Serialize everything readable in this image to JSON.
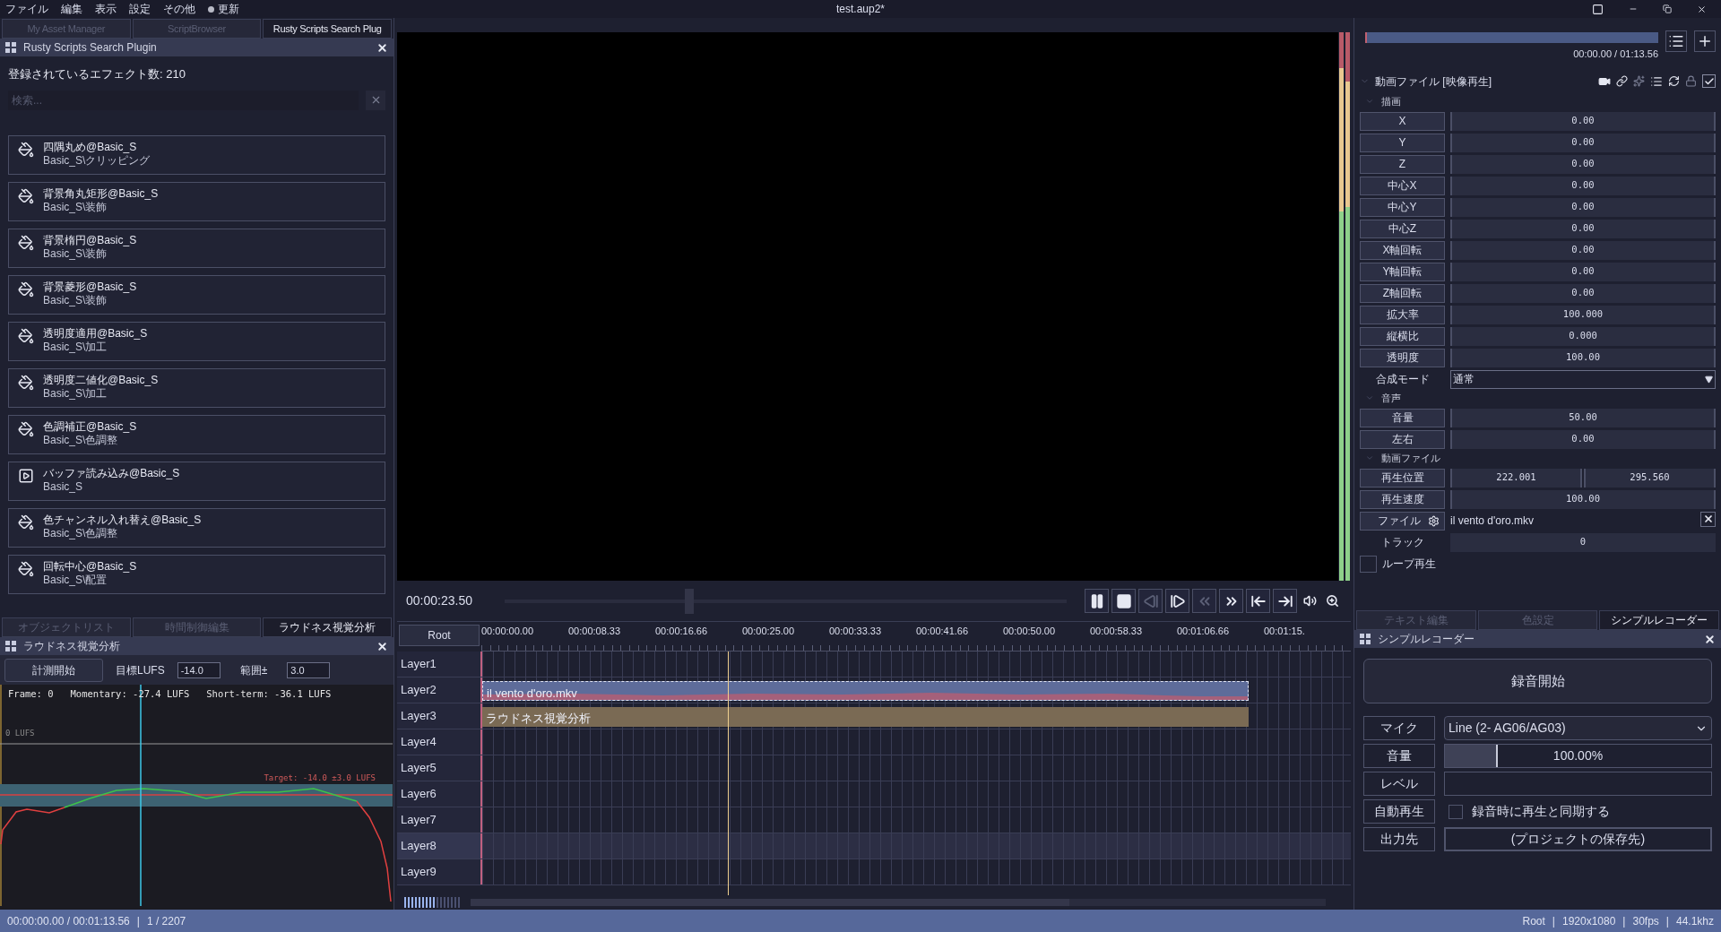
{
  "menu": [
    "ファイル",
    "編集",
    "表示",
    "設定",
    "その他"
  ],
  "update": {
    "label": "更新",
    "pending": true
  },
  "window": {
    "title": "test.aup2*"
  },
  "left_tabs": [
    {
      "label": "My Asset Manager",
      "selected": false
    },
    {
      "label": "ScriptBrowser",
      "selected": false
    },
    {
      "label": "Rusty Scripts Search Plug",
      "selected": true
    }
  ],
  "search_panel": {
    "title": "Rusty Scripts Search Plugin",
    "count": "登録されているエフェクト数: 210",
    "placeholder": "検索...",
    "effects": [
      {
        "name": "四隅丸め@Basic_S",
        "path": "Basic_S\\クリッピング",
        "kind": "filter"
      },
      {
        "name": "背景角丸矩形@Basic_S",
        "path": "Basic_S\\装飾",
        "kind": "filter"
      },
      {
        "name": "背景楕円@Basic_S",
        "path": "Basic_S\\装飾",
        "kind": "filter"
      },
      {
        "name": "背景菱形@Basic_S",
        "path": "Basic_S\\装飾",
        "kind": "filter"
      },
      {
        "name": "透明度適用@Basic_S",
        "path": "Basic_S\\加工",
        "kind": "filter"
      },
      {
        "name": "透明度二値化@Basic_S",
        "path": "Basic_S\\加工",
        "kind": "filter"
      },
      {
        "name": "色調補正@Basic_S",
        "path": "Basic_S\\色調整",
        "kind": "filter"
      },
      {
        "name": "バッファ読み込み@Basic_S",
        "path": "Basic_S",
        "kind": "media"
      },
      {
        "name": "色チャンネル入れ替え@Basic_S",
        "path": "Basic_S\\色調整",
        "kind": "filter"
      },
      {
        "name": "回転中心@Basic_S",
        "path": "Basic_S\\配置",
        "kind": "filter"
      }
    ]
  },
  "bottom_tabs": [
    {
      "label": "オブジェクトリスト",
      "selected": false
    },
    {
      "label": "時間制御編集",
      "selected": false
    },
    {
      "label": "ラウドネス視覚分析",
      "selected": true
    }
  ],
  "loudness": {
    "title": "ラウドネス視覚分析",
    "start": "計測開始",
    "target_label": "目標LUFS",
    "target": "-14.0",
    "range_label": "範囲±",
    "range": "3.0",
    "readout": "Frame: 0   Momentary: -27.4 LUFS   Short-term: -36.1 LUFS",
    "zero_label": "0 LUFS",
    "target_band": "Target: -14.0 ±3.0 LUFS"
  },
  "player": {
    "time": "00:00:23.50",
    "level": 0.32,
    "controls": [
      {
        "kind": "pause",
        "disabled": false
      },
      {
        "kind": "stop",
        "disabled": false
      },
      {
        "kind": "prev",
        "disabled": true
      },
      {
        "kind": "next",
        "disabled": false
      },
      {
        "kind": "rewind",
        "disabled": true
      },
      {
        "kind": "forward",
        "disabled": false
      },
      {
        "kind": "start",
        "disabled": false
      },
      {
        "kind": "end",
        "disabled": false
      },
      {
        "kind": "volume",
        "disabled": false
      },
      {
        "kind": "zoom",
        "disabled": false
      }
    ]
  },
  "timeline": {
    "root": "Root",
    "ticks": [
      "00:00:00.00",
      "00:00:08.33",
      "00:00:16.66",
      "00:00:25.00",
      "00:00:33.33",
      "00:00:41.66",
      "00:00:50.00",
      "00:00:58.33",
      "00:01:06.66",
      "00:01:15."
    ],
    "layers": [
      {
        "name": "Layer1"
      },
      {
        "name": "Layer2",
        "clip": {
          "label": "il vento d'oro.mkv",
          "kind": "video",
          "selected": true
        }
      },
      {
        "name": "Layer3",
        "clip": {
          "label": "ラウドネス視覚分析",
          "kind": "filter",
          "selected": false
        }
      },
      {
        "name": "Layer4"
      },
      {
        "name": "Layer5"
      },
      {
        "name": "Layer6"
      },
      {
        "name": "Layer7"
      },
      {
        "name": "Layer8",
        "selected": true
      },
      {
        "name": "Layer9"
      }
    ]
  },
  "properties": {
    "time": "00:00.00 / 01:13.56",
    "object": "動画ファイル [映像再生]",
    "enabled": true,
    "sections": [
      {
        "title": "描画",
        "rows": [
          {
            "kind": "number",
            "label": "X",
            "values": [
              "0.00"
            ]
          },
          {
            "kind": "number",
            "label": "Y",
            "values": [
              "0.00"
            ]
          },
          {
            "kind": "number",
            "label": "Z",
            "values": [
              "0.00"
            ]
          },
          {
            "kind": "number",
            "label": "中心X",
            "values": [
              "0.00"
            ]
          },
          {
            "kind": "number",
            "label": "中心Y",
            "values": [
              "0.00"
            ]
          },
          {
            "kind": "number",
            "label": "中心Z",
            "values": [
              "0.00"
            ]
          },
          {
            "kind": "number",
            "label": "X軸回転",
            "values": [
              "0.00"
            ]
          },
          {
            "kind": "number",
            "label": "Y軸回転",
            "values": [
              "0.00"
            ]
          },
          {
            "kind": "number",
            "label": "Z軸回転",
            "values": [
              "0.00"
            ]
          },
          {
            "kind": "number",
            "label": "拡大率",
            "values": [
              "100.000"
            ]
          },
          {
            "kind": "number",
            "label": "縦横比",
            "values": [
              "0.000"
            ]
          },
          {
            "kind": "number",
            "label": "透明度",
            "values": [
              "100.00"
            ]
          },
          {
            "kind": "select",
            "label": "合成モード",
            "value": "通常"
          }
        ]
      },
      {
        "title": "音声",
        "rows": [
          {
            "kind": "number",
            "label": "音量",
            "values": [
              "50.00"
            ]
          },
          {
            "kind": "number",
            "label": "左右",
            "values": [
              "0.00"
            ]
          }
        ]
      },
      {
        "title": "動画ファイル",
        "rows": [
          {
            "kind": "number",
            "label": "再生位置",
            "values": [
              "222.001",
              "295.560"
            ]
          },
          {
            "kind": "number",
            "label": "再生速度",
            "values": [
              "100.00"
            ]
          },
          {
            "kind": "file",
            "label": "ファイル",
            "value": "il vento d'oro.mkv"
          },
          {
            "kind": "plain",
            "label": "トラック",
            "value": "0"
          },
          {
            "kind": "checkbox",
            "label": "ループ再生",
            "checked": false
          }
        ]
      }
    ]
  },
  "right_tabs": [
    {
      "label": "テキスト編集",
      "selected": false
    },
    {
      "label": "色設定",
      "selected": false
    },
    {
      "label": "シンプルレコーダー",
      "selected": true
    }
  ],
  "recorder": {
    "title": "シンプルレコーダー",
    "record": "録音開始",
    "rows": [
      {
        "kind": "select",
        "label": "マイク",
        "value": "Line (2- AG06/AG03)"
      },
      {
        "kind": "slider",
        "label": "音量",
        "reading": "100.00%",
        "level": 0.2
      },
      {
        "kind": "meter",
        "label": "レベル"
      },
      {
        "kind": "checkbox",
        "label": "自動再生",
        "text": "録音時に再生と同期する",
        "checked": false
      },
      {
        "kind": "button",
        "label": "出力先",
        "value": "(プロジェクトの保存先)"
      }
    ]
  },
  "status_bar": {
    "left": [
      "00:00:00.00 / 00:01:13.56",
      "|",
      "1 / 2207"
    ],
    "right": [
      "Root",
      "|",
      "1920x1080",
      "|",
      "30fps",
      "|",
      "44.1khz"
    ]
  }
}
